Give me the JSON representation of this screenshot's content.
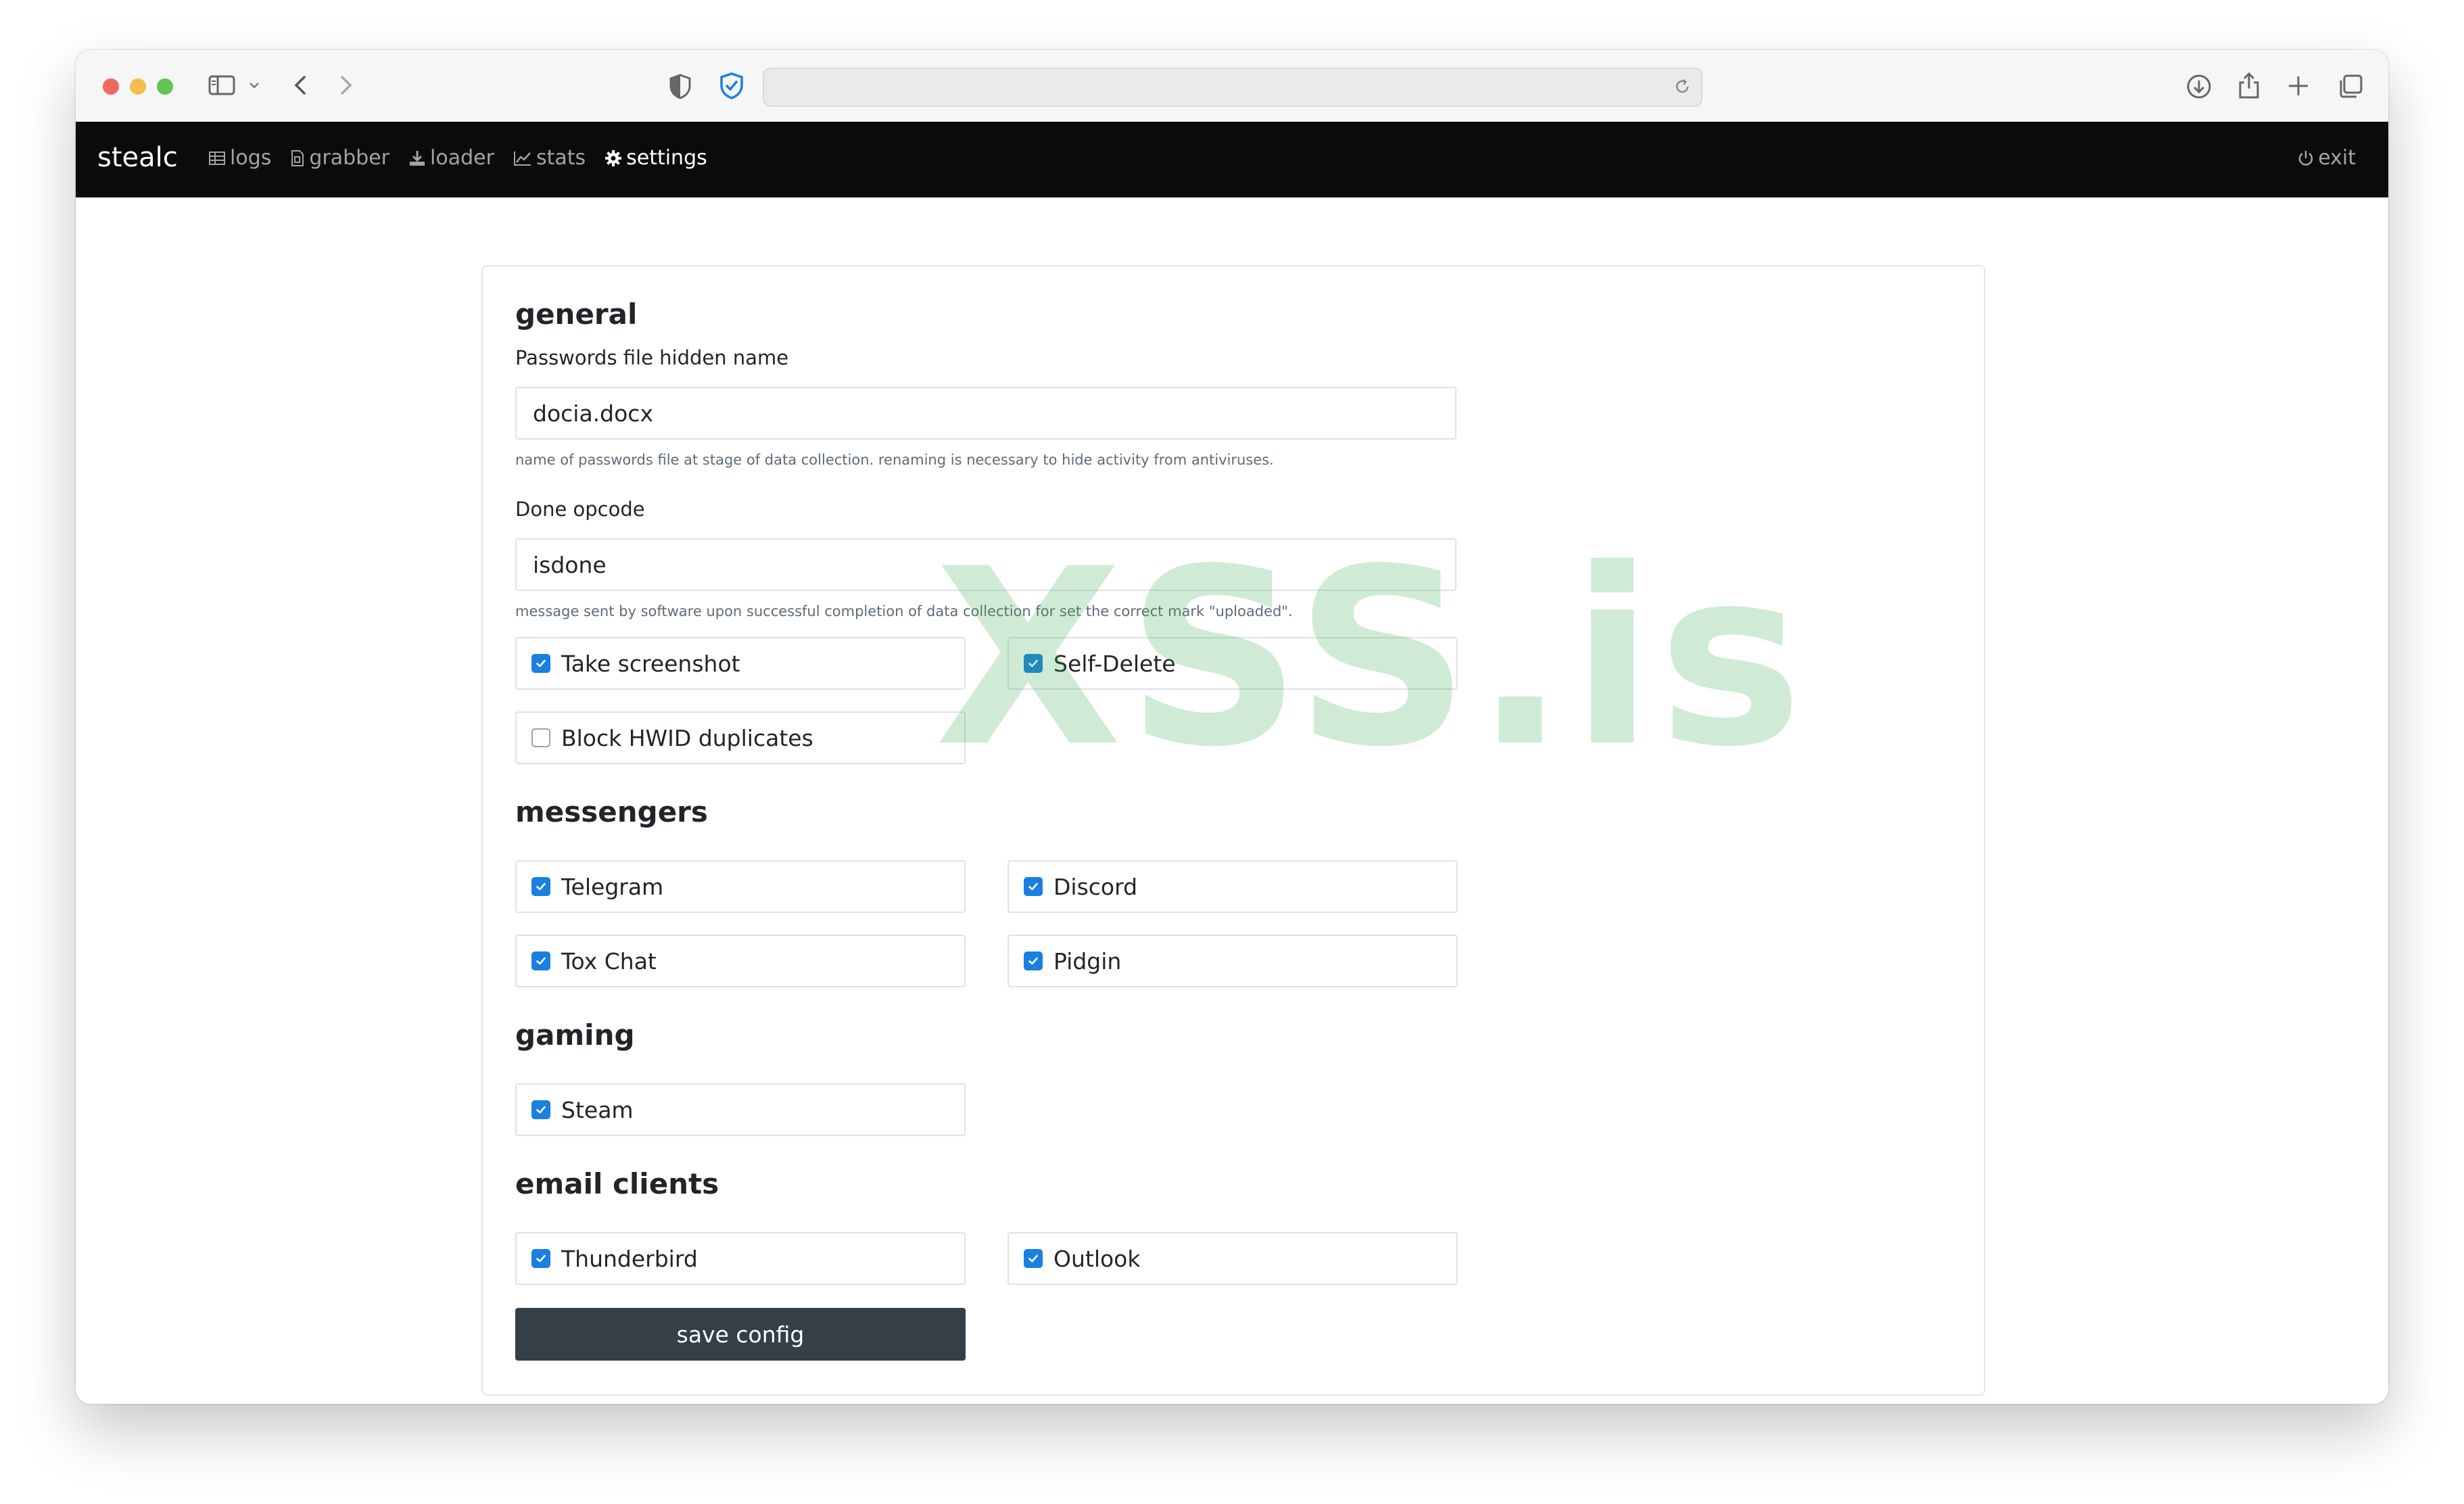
{
  "browser": {
    "address": "",
    "icons": [
      "sidebar-icon",
      "chevron-down-icon",
      "back-icon",
      "forward-icon",
      "privacy-shield-icon",
      "extension-shield-icon",
      "reload-icon",
      "download-icon",
      "share-icon",
      "new-tab-icon",
      "tabs-overview-icon"
    ]
  },
  "navbar": {
    "brand": "stealc",
    "links": [
      {
        "label": "logs",
        "icon": "table-icon"
      },
      {
        "label": "grabber",
        "icon": "file-icon"
      },
      {
        "label": "loader",
        "icon": "download-icon"
      },
      {
        "label": "stats",
        "icon": "chart-icon"
      },
      {
        "label": "settings",
        "icon": "gear-icon",
        "active": true
      }
    ],
    "exit": {
      "label": "exit",
      "icon": "power-icon"
    }
  },
  "settings": {
    "general": {
      "title": "general",
      "password_file": {
        "label": "Passwords file hidden name",
        "value": "docia.docx",
        "help": "name of passwords file at stage of data collection. renaming is necessary to hide activity from antiviruses."
      },
      "done_opcode": {
        "label": "Done opcode",
        "value": "isdone",
        "help": "message sent by software upon successful completion of data collection for set the correct mark \"uploaded\"."
      },
      "options": [
        {
          "label": "Take screenshot",
          "checked": true
        },
        {
          "label": "Self-Delete",
          "checked": true
        },
        {
          "label": "Block HWID duplicates",
          "checked": false
        }
      ]
    },
    "messengers": {
      "title": "messengers",
      "options": [
        {
          "label": "Telegram",
          "checked": true
        },
        {
          "label": "Discord",
          "checked": true
        },
        {
          "label": "Tox Chat",
          "checked": true
        },
        {
          "label": "Pidgin",
          "checked": true
        }
      ]
    },
    "gaming": {
      "title": "gaming",
      "options": [
        {
          "label": "Steam",
          "checked": true
        }
      ]
    },
    "email_clients": {
      "title": "email clients",
      "options": [
        {
          "label": "Thunderbird",
          "checked": true
        },
        {
          "label": "Outlook",
          "checked": true
        }
      ]
    },
    "save_label": "save config"
  },
  "watermark": "XSS.is",
  "colors": {
    "navbar_bg": "#0b0b0c",
    "checkbox_accent": "#1a7fe0",
    "save_button": "#343f48",
    "watermark": "#3caa50"
  }
}
